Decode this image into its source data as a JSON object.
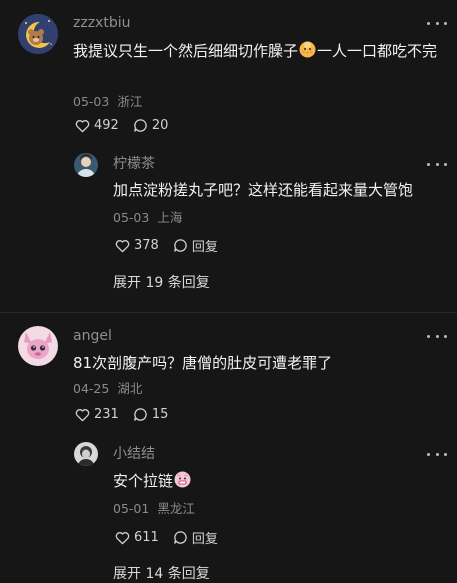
{
  "comments": [
    {
      "username": "zzzxtbiu",
      "text_before": "我提议只生一个然后细细切作臊子",
      "text_after": "一人一口都吃不完",
      "date": "05-03",
      "location": "浙江",
      "likes": "492",
      "replies": "20",
      "reply": {
        "username": "柠檬茶",
        "text": "加点淀粉搓丸子吧？这样还能看起来量大管饱",
        "date": "05-03",
        "location": "上海",
        "likes": "378",
        "reply_label": "回复"
      },
      "expand": "展开 19 条回复"
    },
    {
      "username": "angel",
      "text": "81次剖腹产吗？唐僧的肚皮可遭老罪了",
      "date": "04-25",
      "location": "湖北",
      "likes": "231",
      "replies": "15",
      "reply": {
        "username": "小结结",
        "text": "安个拉链",
        "date": "05-01",
        "location": "黑龙江",
        "likes": "611",
        "reply_label": "回复"
      },
      "expand": "展开 14 条回复"
    }
  ],
  "icons": {
    "like": "heart-outline-icon",
    "comment": "speech-bubble-icon",
    "more": "more-dots-icon"
  },
  "colors": {
    "background": "#161616",
    "text": "#f2f2f2",
    "muted": "#8a8a8a"
  }
}
